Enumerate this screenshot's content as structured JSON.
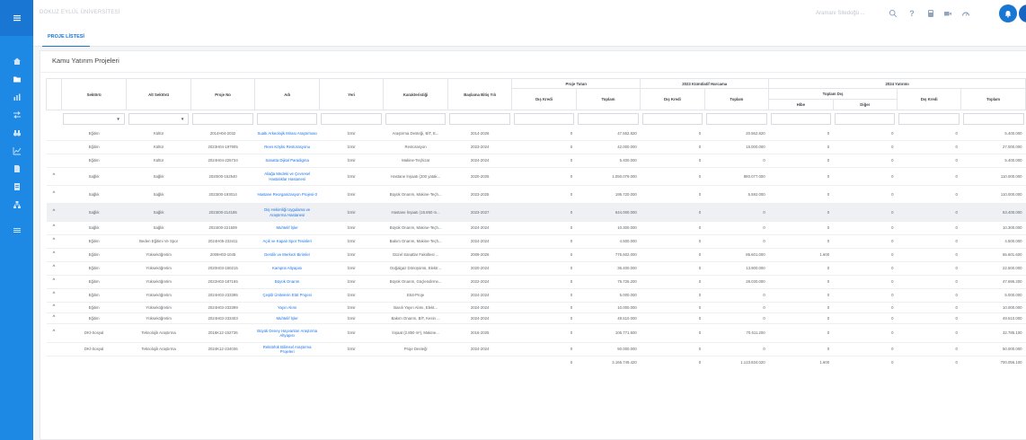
{
  "app": {
    "brand": "DOKUZ EYLÜL ÜNİVERSİTESİ"
  },
  "topbar": {
    "search_placeholder": "Aramanı Sitedoğü ...",
    "help_label": "?"
  },
  "tabs": [
    {
      "label": "PROJE LİSTESİ"
    }
  ],
  "page": {
    "title": "Kamu Yatırım Projeleri"
  },
  "table": {
    "groups": {
      "proje_tutari": "Proje Tutarı",
      "harcama_2023": "2023 Kümülatif Harcama",
      "yatirim_2024": "2024 Yatırımı",
      "toplam_dis": "Toplam Dış"
    },
    "headers": {
      "sektor": "Sektörü",
      "alt_sektor": "Alt Sektörü",
      "proje_no": "Proje No",
      "adi": "Adı",
      "yeri": "Yeri",
      "karakteristik": "Karakteristiği",
      "baslama": "Başlama Bitiş Yılı",
      "dis_kredi": "Dış Kredi",
      "toplam": "Toplam",
      "hibe": "Hibe",
      "diger": "Diğer"
    },
    "rows": [
      {
        "chevron": "",
        "sektor": "Eğitim",
        "alt": "Kültür",
        "no": "2014H04-2032",
        "adi": "Sualtı Arkeolojik Mirası Araştırması",
        "yeri": "İzmir",
        "kar": "Araştırma Desteği, BİT, E...",
        "yil": "2014-2026",
        "pt_dk": "0",
        "pt_top": "47.552.820",
        "kh_dk": "0",
        "kh_top": "20.562.820",
        "hibe": "0",
        "diger": "0",
        "y_dk": "0",
        "y_top": "5.400.000"
      },
      {
        "chevron": "",
        "sektor": "Eğitim",
        "alt": "Kültür",
        "no": "2023H04-197905",
        "adi": "Rees Köşkü Restorasyonu",
        "yeri": "İzmir",
        "kar": "Restorasyon",
        "yil": "2023-2024",
        "pt_dk": "0",
        "pt_top": "42.000.000",
        "kh_dk": "0",
        "kh_top": "15.000.000",
        "hibe": "0",
        "diger": "0",
        "y_dk": "0",
        "y_top": "27.000.000"
      },
      {
        "chevron": "",
        "sektor": "Eğitim",
        "alt": "Kültür",
        "no": "2024H04-225734",
        "adi": "Sanatta Dijital Paradigma",
        "yeri": "İzmir",
        "kar": "Makine-Teçhizat",
        "yil": "2024-2024",
        "pt_dk": "0",
        "pt_top": "5.400.000",
        "kh_dk": "0",
        "kh_top": "0",
        "hibe": "0",
        "diger": "0",
        "y_dk": "0",
        "y_top": "5.400.000"
      },
      {
        "chevron": "^",
        "sektor": "Sağlık",
        "alt": "Sağlık",
        "no": "2020I00-152540",
        "adi": "Aliağa Medeki ve Çevresel Hastalıklar Hastanesi",
        "yeri": "İzmir",
        "kar": "Hastane İnşaatı (200 yatak...",
        "yil": "2020-2025",
        "pt_dk": "0",
        "pt_top": "1.050.079.000",
        "kh_dk": "0",
        "kh_top": "880.077.000",
        "hibe": "0",
        "diger": "0",
        "y_dk": "0",
        "y_top": "110.000.000"
      },
      {
        "chevron": "^",
        "sektor": "Sağlık",
        "alt": "Sağlık",
        "no": "2023I00-193014",
        "adi": "Hastane Reorganizasyon Projesi-3",
        "yeri": "İzmir",
        "kar": "Büyük Onarım, Makine-Teçh...",
        "yil": "2023-2025",
        "pt_dk": "0",
        "pt_top": "195.720.000",
        "kh_dk": "0",
        "kh_top": "5.592.000",
        "hibe": "0",
        "diger": "0",
        "y_dk": "0",
        "y_top": "110.000.000"
      },
      {
        "chevron": "^",
        "sektor": "Sağlık",
        "alt": "Sağlık",
        "no": "2023I00-214185",
        "adi": "Diş Hekimliği Uygulama ve Araştırma Hastanesi",
        "yeri": "İzmir",
        "kar": "Hastane İnşaatı (15.850 m...",
        "yil": "2023-2027",
        "pt_dk": "0",
        "pt_top": "644.000.000",
        "kh_dk": "0",
        "kh_top": "0",
        "hibe": "0",
        "diger": "0",
        "y_dk": "0",
        "y_top": "63.400.000"
      },
      {
        "chevron": "^",
        "sektor": "Sağlık",
        "alt": "Sağlık",
        "no": "2024I00-221509",
        "adi": "Muhtelif İşler",
        "yeri": "İzmir",
        "kar": "Büyük Onarım, Makine-Teçh...",
        "yil": "2024-2024",
        "pt_dk": "0",
        "pt_top": "10.300.000",
        "kh_dk": "0",
        "kh_top": "0",
        "hibe": "0",
        "diger": "0",
        "y_dk": "0",
        "y_top": "10.300.000"
      },
      {
        "chevron": "^",
        "sektor": "Eğitim",
        "alt": "Beden Eğitimi Ve Spor",
        "no": "2024H05-233411",
        "adi": "Açık ve Kapalı Spor Tesisleri",
        "yeri": "İzmir",
        "kar": "Bakım Onarım, Makine-Teçh...",
        "yil": "2024-2024",
        "pt_dk": "0",
        "pt_top": "4.500.000",
        "kh_dk": "0",
        "kh_top": "0",
        "hibe": "0",
        "diger": "0",
        "y_dk": "0",
        "y_top": "4.500.000"
      },
      {
        "chevron": "^",
        "sektor": "Eğitim",
        "alt": "Yükseköğretim",
        "no": "2009H03-1045",
        "adi": "Derslik ve Merkezi Birimler",
        "yeri": "İzmir",
        "kar": "Güzel Sanatlar Fakültesi ...",
        "yil": "2009-2026",
        "pt_dk": "0",
        "pt_top": "776.602.000",
        "kh_dk": "0",
        "kh_top": "86.601.000",
        "hibe": "1.600",
        "diger": "0",
        "y_dk": "0",
        "y_top": "65.601.600"
      },
      {
        "chevron": "^",
        "sektor": "Eğitim",
        "alt": "Yükseköğretim",
        "no": "2020H03-150215",
        "adi": "Kampüs Altyapısı",
        "yeri": "İzmir",
        "kar": "Doğalgaz Dönüşümü, Elektr...",
        "yil": "2020-2024",
        "pt_dk": "0",
        "pt_top": "36.400.000",
        "kh_dk": "0",
        "kh_top": "13.900.000",
        "hibe": "0",
        "diger": "0",
        "y_dk": "0",
        "y_top": "22.500.000"
      },
      {
        "chevron": "^",
        "sektor": "Eğitim",
        "alt": "Yükseköğretim",
        "no": "2022H03-187165",
        "adi": "Büyük Onarım",
        "yeri": "İzmir",
        "kar": "Büyük Onarım, Güçlendirme...",
        "yil": "2022-2024",
        "pt_dk": "0",
        "pt_top": "75.726.200",
        "kh_dk": "0",
        "kh_top": "28.030.000",
        "hibe": "0",
        "diger": "0",
        "y_dk": "0",
        "y_top": "47.696.200"
      },
      {
        "chevron": "^",
        "sektor": "Eğitim",
        "alt": "Yükseköğretim",
        "no": "2024H03-233395",
        "adi": "Çeşitli Ünitelerin Etüt Projesi",
        "yeri": "İzmir",
        "kar": "Etüt-Proje",
        "yil": "2024-2024",
        "pt_dk": "0",
        "pt_top": "5.000.000",
        "kh_dk": "0",
        "kh_top": "0",
        "hibe": "0",
        "diger": "0",
        "y_dk": "0",
        "y_top": "5.000.000"
      },
      {
        "chevron": "^",
        "sektor": "Eğitim",
        "alt": "Yükseköğretim",
        "no": "2024H03-233399",
        "adi": "Yayın Alımı",
        "yeri": "İzmir",
        "kar": "Basılı Yayın Alımı, Elekt...",
        "yil": "2024-2024",
        "pt_dk": "0",
        "pt_top": "10.000.000",
        "kh_dk": "0",
        "kh_top": "0",
        "hibe": "0",
        "diger": "0",
        "y_dk": "0",
        "y_top": "10.000.000"
      },
      {
        "chevron": "^",
        "sektor": "Eğitim",
        "alt": "Yükseköğretim",
        "no": "2024H03-233403",
        "adi": "Muhtelif İşler",
        "yeri": "İzmir",
        "kar": "Bakım Onarım, BİT, Kesin ...",
        "yil": "2024-2024",
        "pt_dk": "0",
        "pt_top": "49.510.000",
        "kh_dk": "0",
        "kh_top": "0",
        "hibe": "0",
        "diger": "0",
        "y_dk": "0",
        "y_top": "49.510.000"
      },
      {
        "chevron": "^",
        "sektor": "DKİ-Sosyal",
        "alt": "Teknolojik Araştırma",
        "no": "2016K12-152736",
        "adi": "Büyük Deney Hayvanları Araştırma Altyapısı",
        "yeri": "İzmir",
        "kar": "İnşaat (2.850 m²), Makine...",
        "yil": "2016-2025",
        "pt_dk": "0",
        "pt_top": "106.771.600",
        "kh_dk": "0",
        "kh_top": "70.611.200",
        "hibe": "0",
        "diger": "0",
        "y_dk": "0",
        "y_top": "32.785.100"
      },
      {
        "chevron": "",
        "sektor": "DKİ-Sosyal",
        "alt": "Teknolojik Araştırma",
        "no": "2024K12-234036",
        "adi": "Rektörlük Bilimsel Araştırma Projeleri",
        "yeri": "İzmir",
        "kar": "Proje Desteği",
        "yil": "2024-2024",
        "pt_dk": "0",
        "pt_top": "50.000.000",
        "kh_dk": "0",
        "kh_top": "0",
        "hibe": "0",
        "diger": "0",
        "y_dk": "0",
        "y_top": "50.000.000"
      }
    ],
    "totals": {
      "pt_dk": "0",
      "pt_top": "3.165.749.420",
      "kh_dk": "0",
      "kh_top": "1.123.834.020",
      "hibe": "1.600",
      "diger": "0",
      "y_dk": "0",
      "y_top": "700.056.100"
    }
  }
}
